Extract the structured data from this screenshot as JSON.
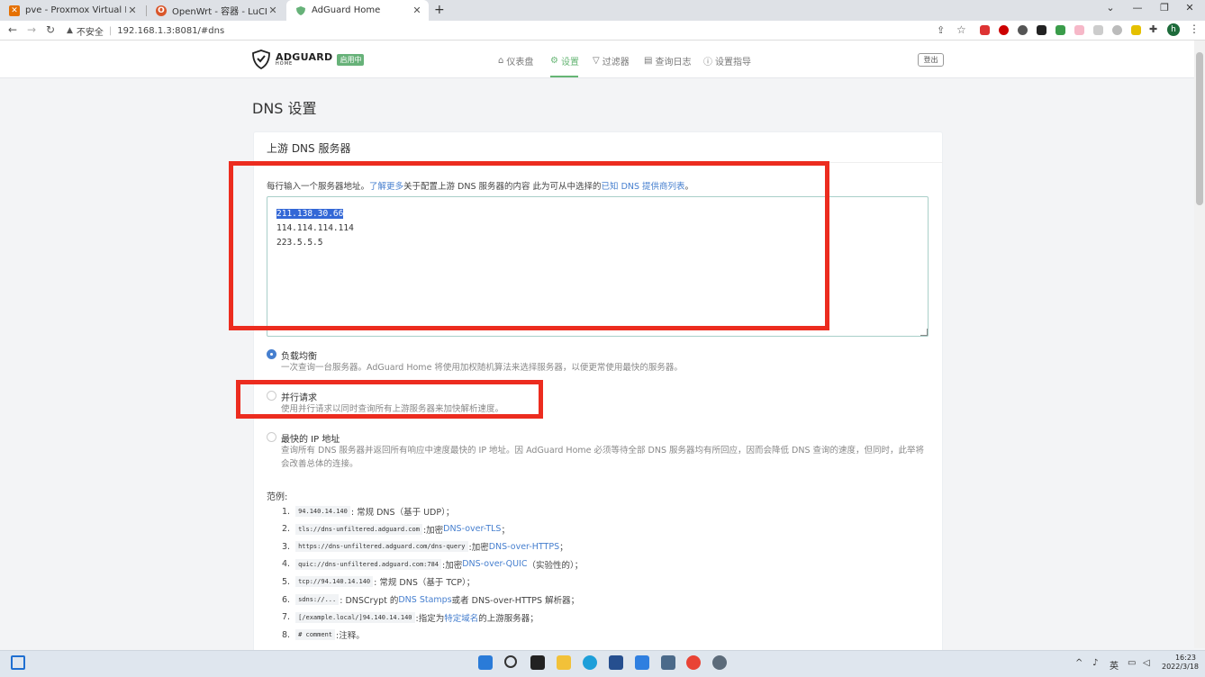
{
  "browser": {
    "tabs": [
      {
        "title": "pve - Proxmox Virtual Environment",
        "icon": "proxmox-icon"
      },
      {
        "title": "OpenWrt - 容器 - LuCI",
        "icon": "openwrt-icon"
      },
      {
        "title": "AdGuard Home",
        "icon": "adguard-shield-icon"
      }
    ],
    "new_tab": "+",
    "security_label": "不安全",
    "url": "192.168.1.3:8081/#dns"
  },
  "app": {
    "brand": "ADGUARD",
    "brand_sub": "HOME",
    "status_badge": "启用中",
    "nav": [
      {
        "label": "仪表盘",
        "icon": "home-icon"
      },
      {
        "label": "设置",
        "icon": "gear-icon"
      },
      {
        "label": "过滤器",
        "icon": "filter-icon"
      },
      {
        "label": "查询日志",
        "icon": "log-icon"
      },
      {
        "label": "设置指导",
        "icon": "help-icon"
      }
    ],
    "logout": "登出"
  },
  "page": {
    "title": "DNS 设置",
    "card_title": "上游 DNS 服务器",
    "help_prefix": "每行输入一个服务器地址。",
    "help_link1": "了解更多",
    "help_mid": "关于配置上游 DNS 服务器的内容 此为可从中选择的",
    "help_link2": "已知 DNS 提供商列表",
    "help_suffix": "。",
    "upstreams": [
      "211.138.30.66",
      "114.114.114.114",
      "223.5.5.5"
    ],
    "modes": [
      {
        "title": "负载均衡",
        "desc": "一次查询一台服务器。AdGuard Home 将使用加权随机算法来选择服务器，以便更常使用最快的服务器。",
        "selected": true
      },
      {
        "title": "并行请求",
        "desc": "使用并行请求以同时查询所有上游服务器来加快解析速度。",
        "selected": false
      },
      {
        "title": "最快的 IP 地址",
        "desc": "查询所有 DNS 服务器并返回所有响应中速度最快的 IP 地址。因 AdGuard Home 必须等待全部 DNS 服务器均有所回应，因而会降低 DNS 查询的速度，但同时，此举将会改善总体的连接。",
        "selected": false
      }
    ],
    "examples_label": "范例:",
    "examples": [
      {
        "num": "1.",
        "code": "94.140.14.140",
        "text": ": 常规 DNS（基于 UDP）；",
        "link": "",
        "tail": ""
      },
      {
        "num": "2.",
        "code": "tls://dns-unfiltered.adguard.com",
        "text": ":加密 ",
        "link": "DNS-over-TLS",
        "tail": "；"
      },
      {
        "num": "3.",
        "code": "https://dns-unfiltered.adguard.com/dns-query",
        "text": ":加密 ",
        "link": "DNS-over-HTTPS",
        "tail": "；"
      },
      {
        "num": "4.",
        "code": "quic://dns-unfiltered.adguard.com:784",
        "text": ":加密 ",
        "link": "DNS-over-QUIC",
        "tail": "（实验性的）；"
      },
      {
        "num": "5.",
        "code": "tcp://94.140.14.140",
        "text": ": 常规 DNS（基于 TCP）；",
        "link": "",
        "tail": ""
      },
      {
        "num": "6.",
        "code": "sdns://...",
        "text": ": DNSCrypt 的 ",
        "link": "DNS Stamps",
        "tail": " 或者 DNS-over-HTTPS 解析器；"
      },
      {
        "num": "7.",
        "code": "[/example.local/]94.140.14.140",
        "text": ":指定为",
        "link": "特定域名",
        "tail": "的上游服务器；"
      },
      {
        "num": "8.",
        "code": "# comment",
        "text": ":注释。",
        "link": "",
        "tail": ""
      }
    ]
  },
  "taskbar": {
    "ime": "英",
    "time": "16:23",
    "date": "2022/3/18"
  },
  "colors": {
    "accent_green": "#66b574",
    "link_blue": "#467fcf",
    "annotation_red": "#ec2c1f"
  }
}
